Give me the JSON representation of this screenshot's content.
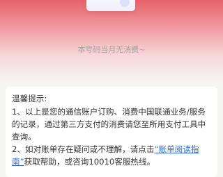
{
  "empty_state": {
    "message": "本号码当月无消费~"
  },
  "tips": {
    "title": "温馨提示:",
    "item1": "1、以上是您的通信账户订购、消费中国联通业务/服务的记录，通过第三方支付的消费请您至所用支付工具中查询。",
    "item2_before": "2、如对账单存在疑问或不理解，请点击",
    "item2_link": "“账单阅读指南”",
    "item2_after": "获取帮助，或咨询10010客服热线。"
  }
}
